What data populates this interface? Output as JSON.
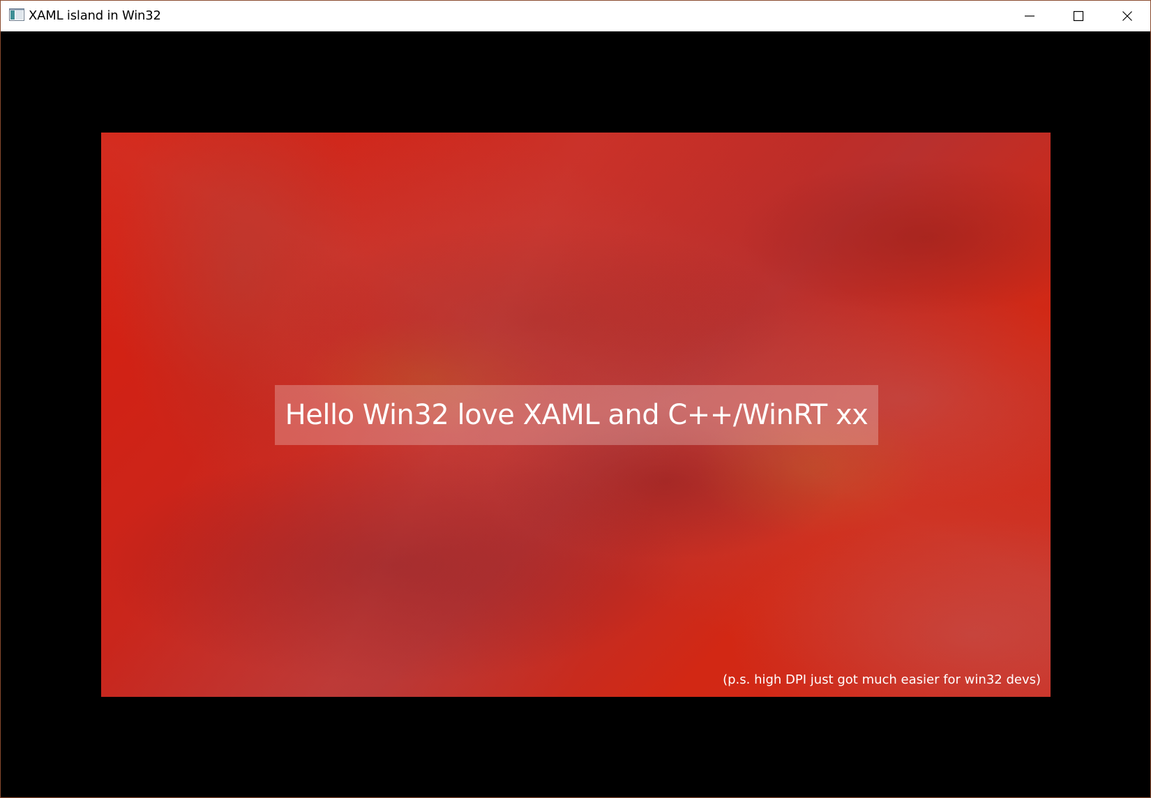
{
  "window": {
    "title": "XAML island in Win32",
    "caption_buttons": {
      "minimize_icon": "minimize-icon",
      "maximize_icon": "maximize-icon",
      "close_icon": "close-icon"
    },
    "app_icon": "window-app-icon"
  },
  "island": {
    "hello_text": "Hello Win32 love XAML and C++/WinRT xx",
    "ps_text": "(p.s. high DPI just got much easier for win32 devs)"
  },
  "colors": {
    "client_background": "#000000",
    "island_primary": "#d91e0e",
    "window_border": "#8a4a2e"
  }
}
